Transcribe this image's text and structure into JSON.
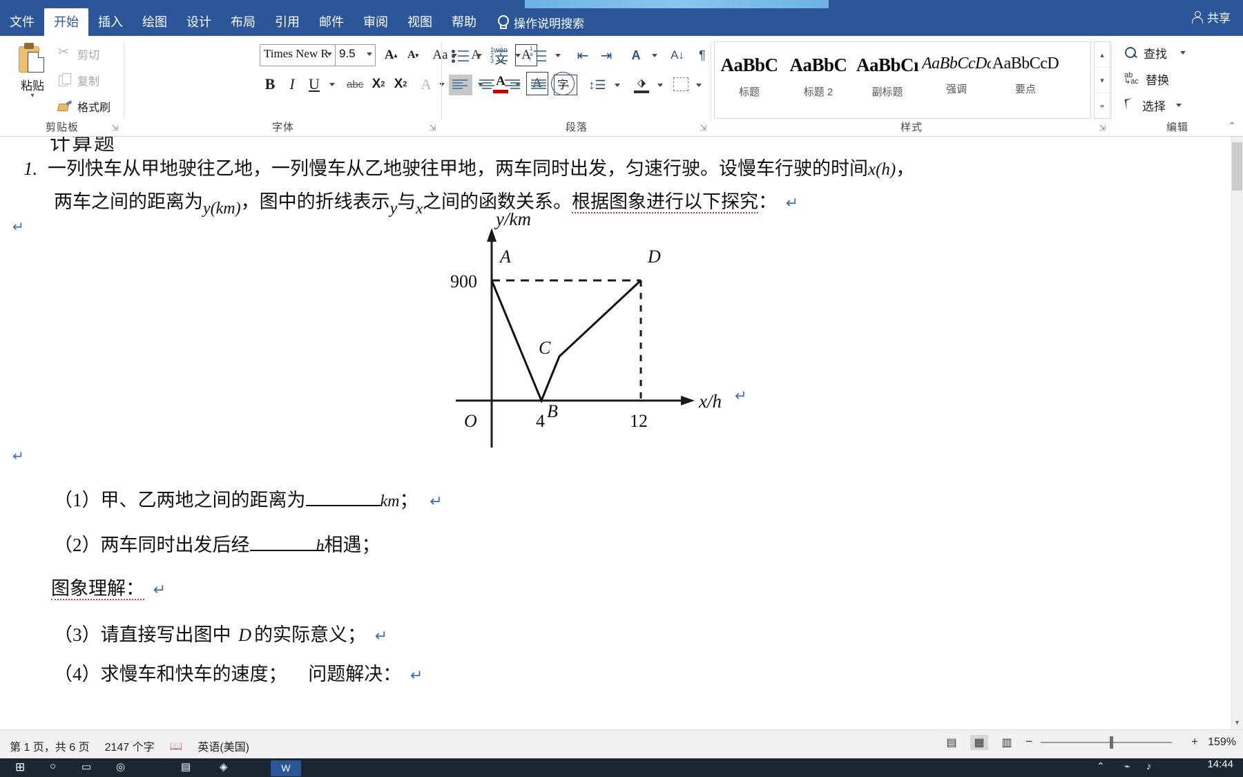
{
  "app": {
    "tabs": [
      {
        "label": "文件",
        "active": false
      },
      {
        "label": "开始",
        "active": true
      },
      {
        "label": "插入",
        "active": false
      },
      {
        "label": "绘图",
        "active": false
      },
      {
        "label": "设计",
        "active": false
      },
      {
        "label": "布局",
        "active": false
      },
      {
        "label": "引用",
        "active": false
      },
      {
        "label": "邮件",
        "active": false
      },
      {
        "label": "审阅",
        "active": false
      },
      {
        "label": "视图",
        "active": false
      },
      {
        "label": "帮助",
        "active": false
      }
    ],
    "tell_me": "操作说明搜索",
    "share_label": "共享",
    "accent_color": "#2b579a"
  },
  "ribbon": {
    "clipboard": {
      "group_label": "剪贴板",
      "paste_label": "粘贴",
      "cut_label": "剪切",
      "copy_label": "复制",
      "format_painter_label": "格式刷"
    },
    "font": {
      "group_label": "字体",
      "font_name": "Times New R",
      "font_size": "9.5",
      "bold": "B",
      "italic": "I",
      "underline": "U",
      "strikethrough": "abc",
      "subscript_x": "X",
      "subscript_n": "2",
      "superscript_x": "X",
      "superscript_n": "2",
      "grow_font": "A",
      "shrink_font": "A",
      "change_case": "Aa",
      "phonetic": "文",
      "enclose_char": "字",
      "char_border": "A",
      "text_effects": "A",
      "highlight": "ab",
      "font_color": "A",
      "clear_format": "A"
    },
    "paragraph": {
      "group_label": "段落"
    },
    "styles": {
      "group_label": "样式",
      "items": [
        {
          "preview": "AaBbC",
          "name": "标题",
          "style": "bold"
        },
        {
          "preview": "AaBbC",
          "name": "标题 2",
          "style": "bold"
        },
        {
          "preview": "AaBbCı",
          "name": "副标题",
          "style": "bold"
        },
        {
          "preview": "AaBbCcDc",
          "name": "强调",
          "style": "italic"
        },
        {
          "preview": "AaBbCcD",
          "name": "要点",
          "style": "plain"
        }
      ]
    },
    "editing": {
      "group_label": "编辑",
      "find_label": "查找",
      "replace_label": "替换",
      "select_label": "选择"
    }
  },
  "document": {
    "clipped_heading": "计算题",
    "problem_number": "1.",
    "line1_part1": "一列快车从甲地驶往乙地，一列慢车从乙地驶往甲地，两车同时出发，匀速行驶。设慢车行驶的时间",
    "line1_math": "x(h)",
    "line1_end": "，",
    "line2_part1": "两车之间的距离为",
    "line2_math1": "y(km)",
    "line2_part2": "，图中的折线表示",
    "line2_math2": "y",
    "line2_part3": "与",
    "line2_math3": "x",
    "line2_part4": "之间的函数关系。",
    "line2_underlined": "根据图象进行以下探究",
    "line2_colon": "：",
    "q1": "（1）甲、乙两地之间的距离为",
    "q1_unit": "km",
    "q1_end": "；",
    "q2": "（2）两车同时出发后经",
    "q2_unit": "h",
    "q2_end": "相遇；",
    "subhead": "图象理解：",
    "q3": "（3）请直接写出图中",
    "q3_point": "D",
    "q3_end": "的实际意义；",
    "q4": "（4）求慢车和快车的速度；",
    "q4_tail": "问题解决：",
    "pilcrow": "↵"
  },
  "chart_data": {
    "type": "line",
    "title": "",
    "xlabel": "x/h",
    "ylabel": "y/km",
    "xlim": [
      0,
      14
    ],
    "ylim": [
      0,
      1050
    ],
    "x_ticks": [
      "4",
      "12"
    ],
    "x_tick_values": [
      4,
      12
    ],
    "y_ticks": [
      "900"
    ],
    "y_tick_values": [
      900
    ],
    "origin_label": "O",
    "grid": false,
    "legend": "none",
    "series": [
      {
        "name": "两车之间的距离",
        "points": [
          {
            "label": "A",
            "x": 0,
            "y": 900
          },
          {
            "label": "B",
            "x": 4,
            "y": 0
          },
          {
            "label": "C",
            "x": 6,
            "y": 330
          },
          {
            "label": "D",
            "x": 12,
            "y": 900
          }
        ]
      }
    ],
    "point_labels": [
      "A",
      "B",
      "C",
      "D"
    ],
    "dashed_guides": [
      {
        "from": [
          0,
          900
        ],
        "to": [
          12,
          900
        ],
        "style": "dashed"
      },
      {
        "from": [
          12,
          900
        ],
        "to": [
          12,
          0
        ],
        "style": "dashed"
      }
    ]
  },
  "status": {
    "page_info": "第 1 页，共 6 页",
    "word_count": "2147 个字",
    "proofing_icon": "proofing-icon",
    "language": "英语(美国)",
    "zoom_level": "159%",
    "zoom_out": "−",
    "zoom_in": "+"
  },
  "taskbar": {
    "time": "14:44"
  }
}
